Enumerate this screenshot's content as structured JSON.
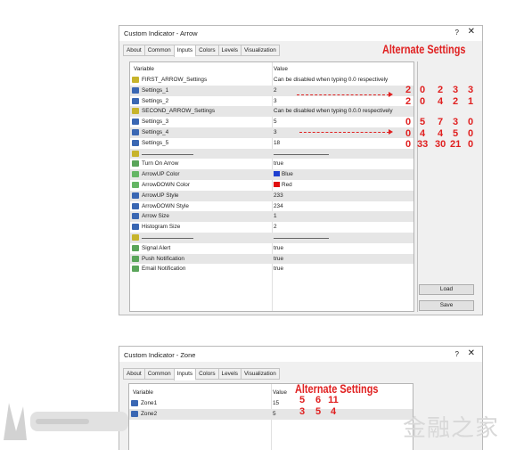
{
  "dialog_arrow": {
    "title": "Custom Indicator - Arrow",
    "help": "?",
    "close": "✕",
    "tabs": [
      "About",
      "Common",
      "Inputs",
      "Colors",
      "Levels",
      "Visualization"
    ],
    "active_tab": "Inputs",
    "columns": {
      "variable": "Variable",
      "value": "Value"
    },
    "rows": [
      {
        "type": "str",
        "name": "FIRST_ARROW_Settings",
        "value": "Can be disabled when typing 0.0 respectively"
      },
      {
        "type": "int",
        "name": "Settings_1",
        "value": "2"
      },
      {
        "type": "int",
        "name": "Settings_2",
        "value": "3"
      },
      {
        "type": "str",
        "name": "SECOND_ARROW_Settings",
        "value": "Can be disabled when typing 0.0.0 respectively"
      },
      {
        "type": "int",
        "name": "Settings_3",
        "value": "5"
      },
      {
        "type": "int",
        "name": "Settings_4",
        "value": "3"
      },
      {
        "type": "int",
        "name": "Settings_5",
        "value": "18"
      },
      {
        "type": "str",
        "name": "separator",
        "value": "separator"
      },
      {
        "type": "bool",
        "name": "Turn On Arrow",
        "value": "true"
      },
      {
        "type": "clr",
        "name": "ArrowUP Color",
        "value": "Blue",
        "color": "#1f3fd0"
      },
      {
        "type": "clr",
        "name": "ArrowDOWN Color",
        "value": "Red",
        "color": "#e01010"
      },
      {
        "type": "int",
        "name": "ArrowUP Style",
        "value": "233"
      },
      {
        "type": "int",
        "name": "ArrowDOWN Style",
        "value": "234"
      },
      {
        "type": "int",
        "name": "Arrow Size",
        "value": "1"
      },
      {
        "type": "int",
        "name": "Histogram Size",
        "value": "2"
      },
      {
        "type": "str",
        "name": "separator",
        "value": "separator"
      },
      {
        "type": "bool",
        "name": "Signal Alert",
        "value": "true"
      },
      {
        "type": "bool",
        "name": "Push Notification",
        "value": "true"
      },
      {
        "type": "bool",
        "name": "Email Notification",
        "value": "true"
      }
    ],
    "buttons": {
      "load": "Load",
      "save": "Save"
    }
  },
  "dialog_zone": {
    "title": "Custom Indicator - Zone",
    "help": "?",
    "close": "✕",
    "tabs": [
      "About",
      "Common",
      "Inputs",
      "Colors",
      "Levels",
      "Visualization"
    ],
    "active_tab": "Inputs",
    "columns": {
      "variable": "Variable",
      "value": "Value"
    },
    "rows": [
      {
        "type": "int",
        "name": "Zone1",
        "value": "15"
      },
      {
        "type": "int",
        "name": "Zone2",
        "value": "5"
      }
    ]
  },
  "annotations": {
    "title_arrow": "Alternate Settings",
    "title_zone": "Alternate Settings",
    "arrow_table": [
      [
        "2",
        "0",
        "2",
        "3",
        "3"
      ],
      [
        "2",
        "0",
        "4",
        "2",
        "1"
      ],
      [
        "0",
        "5",
        "7",
        "3",
        "0"
      ],
      [
        "0",
        "4",
        "4",
        "5",
        "0"
      ],
      [
        "0",
        "33",
        "30",
        "21",
        "0"
      ]
    ],
    "zone_table": [
      [
        "5",
        "6",
        "11"
      ],
      [
        "3",
        "5",
        "4"
      ]
    ],
    "color": "#e02020"
  },
  "watermark": {
    "text": "金融之家"
  }
}
